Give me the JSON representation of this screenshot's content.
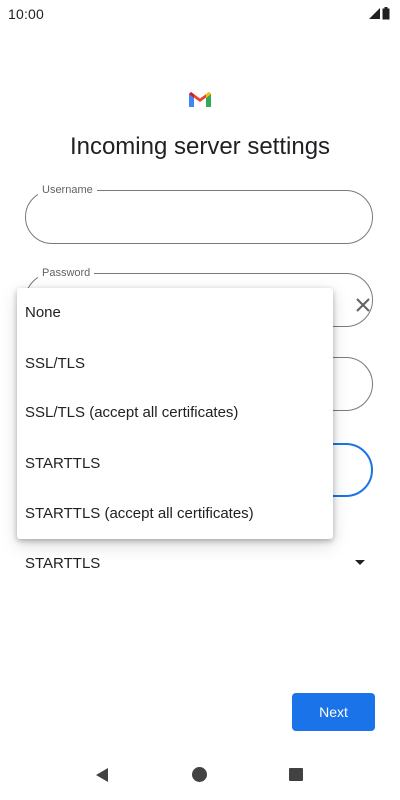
{
  "status_bar": {
    "time": "10:00",
    "icons": [
      "signal-icon",
      "battery-icon"
    ]
  },
  "app": {
    "logo": "gmail-logo"
  },
  "page_title": "Incoming server settings",
  "fields": {
    "username": {
      "label": "Username",
      "value": ""
    },
    "password": {
      "label": "Password",
      "value": ""
    }
  },
  "security": {
    "selected": "STARTTLS",
    "options": [
      "None",
      "SSL/TLS",
      "SSL/TLS (accept all certificates)",
      "STARTTLS",
      "STARTTLS (accept all certificates)"
    ]
  },
  "actions": {
    "next_label": "Next"
  },
  "nav_bar": {
    "icons": [
      "back-icon",
      "home-icon",
      "recents-icon"
    ]
  },
  "colors": {
    "accent": "#1a73e8",
    "text": "#202124",
    "outline": "#7a7a7a"
  }
}
